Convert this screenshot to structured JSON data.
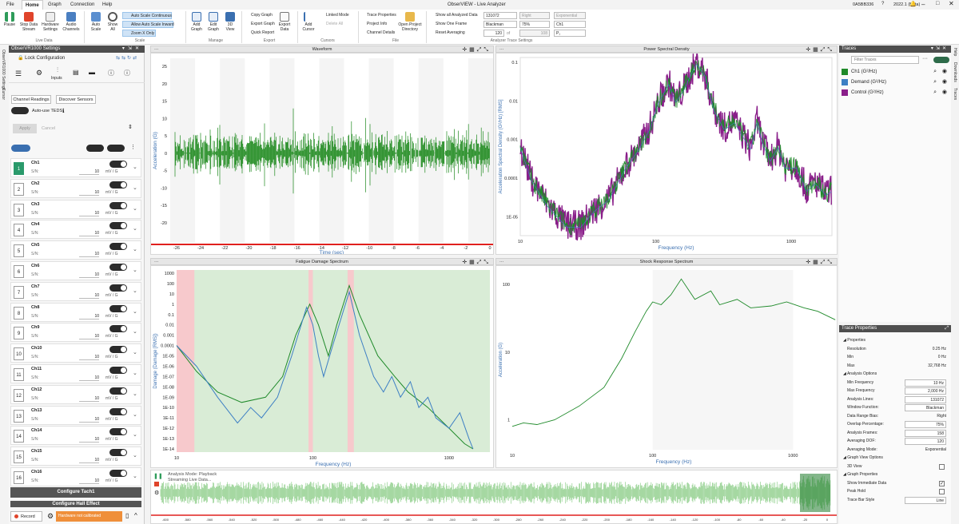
{
  "window": {
    "title": "ObserVIEW - Live Analyzer",
    "device": "0A5BB336",
    "version": "2022.1 (Beta)"
  },
  "menu": [
    "File",
    "Home",
    "Graph",
    "Connection",
    "Help"
  ],
  "ribbon": {
    "pause": "Pause",
    "stop": "Stop Data Stream",
    "hardware": "Hardware Settings",
    "audio": "Audio Channels",
    "auto_scale": "Auto Scale",
    "show_all": "Show All",
    "auto_scale_continuous": "Auto Scale Continuous",
    "allow_auto_scale_inward": "Allow Auto Scale Inward",
    "zoom_x_only": "Zoom X Only",
    "add_graph": "Add Graph",
    "edit_graph": "Edit Graph",
    "view_3d": "3D View",
    "copy_graph": "Copy Graph",
    "export_graph": "Export Graph",
    "quick_report": "Quick Report",
    "export_data": "Export Data",
    "add_cursor": "Add Cursor",
    "linked_mode": "Linked Mode",
    "delete_all": "Delete All",
    "trace_properties": "Trace Properties",
    "project_info": "Project Info",
    "channel_details": "Channel Details",
    "open_project_dir": "Open Project Directory",
    "show_all_analyzed": "Show all Analyzed Data",
    "show_one_frame": "Show One Frame",
    "reset_averaging": "Reset Averaging",
    "lines_value": "131072",
    "window_value": "Blackman",
    "overlap_value": "75%",
    "avg_value": "120",
    "avg_of": "of",
    "avg_total": "108",
    "bias_value": "Right",
    "ch_value": "Ch1",
    "mode_value": "Exponential",
    "unit_value": "P₁",
    "groups": [
      "Live Data",
      "Scale",
      "Manage",
      "Export",
      "Cursors",
      "File",
      "Analyzer Trace Settings"
    ]
  },
  "left_panel": {
    "title": "ObserVR1000 Settings",
    "lock": "Lock Configuration",
    "inputs_tab": "Inputs",
    "channel_readings": "Channel Readings",
    "discover_sensors": "Discover Sensors",
    "auto_teds": "Auto-use TEDS",
    "apply": "Apply",
    "cancel": "Cancel",
    "sn_label": "S/N:",
    "sensitivity": "10",
    "unit": "mV / G",
    "channels": [
      "Ch1",
      "Ch2",
      "Ch3",
      "Ch4",
      "Ch5",
      "Ch6",
      "Ch7",
      "Ch8",
      "Ch9",
      "Ch10",
      "Ch11",
      "Ch12",
      "Ch13",
      "Ch14",
      "Ch15",
      "Ch16"
    ],
    "numbers": [
      "1",
      "2",
      "3",
      "4",
      "5",
      "6",
      "7",
      "8",
      "9",
      "10",
      "11",
      "12",
      "13",
      "14",
      "15",
      "16"
    ],
    "configure_tach": "Configure Tach1",
    "configure_hall": "Configure Hall Effect",
    "record": "Record",
    "hw_not_calibrated": "Hardware not calibrated",
    "vertical_tabs": [
      "ObserVR1000 Settings",
      "Cursor"
    ]
  },
  "graphs": {
    "waveform": {
      "title": "Waveform",
      "xlabel": "Time (sec)",
      "ylabel": "Acceleration (G)",
      "xticks": [
        "-26",
        "-24",
        "-22",
        "-20",
        "-18",
        "-16",
        "-14",
        "-12",
        "-10",
        "-8",
        "-6",
        "-4",
        "-2",
        "0"
      ],
      "yticks": [
        "25",
        "20",
        "15",
        "10",
        "5",
        "0",
        "-5",
        "-10",
        "-15",
        "-20"
      ]
    },
    "psd": {
      "title": "Power Spectral Density",
      "xlabel": "Frequency (Hz)",
      "ylabel": "Acceleration Spectral Density (G²/Hz) [RMS]",
      "xticks": [
        "10",
        "100",
        "1000"
      ],
      "yticks": [
        "0.1",
        "0.01",
        "0.001",
        "0.0001",
        "1E-05"
      ]
    },
    "fds": {
      "title": "Fatigue Damage Spectrum",
      "xlabel": "Frequency (Hz)",
      "ylabel": "Damage (Damage [RMS])",
      "xticks": [
        "10",
        "100",
        "1000"
      ],
      "yticks": [
        "1000",
        "100",
        "10",
        "1",
        "0.1",
        "0.01",
        "0.001",
        "0.0001",
        "1E-05",
        "1E-06",
        "1E-07",
        "1E-08",
        "1E-09",
        "1E-10",
        "1E-11",
        "1E-12",
        "1E-13",
        "1E-14"
      ]
    },
    "srs": {
      "title": "Shock Response Spectrum",
      "xlabel": "Frequency (Hz)",
      "ylabel": "Acceleration (G)",
      "xticks": [
        "10",
        "100",
        "1000"
      ],
      "yticks": [
        "100",
        "10",
        "1"
      ]
    },
    "playback": {
      "mode": "Analysis Mode: Playback",
      "streaming": "Streaming Live Data...",
      "xticks": [
        "-600",
        "-580",
        "-560",
        "-540",
        "-520",
        "-500",
        "-480",
        "-460",
        "-440",
        "-420",
        "-400",
        "-380",
        "-360",
        "-340",
        "-320",
        "-300",
        "-280",
        "-260",
        "-240",
        "-220",
        "-200",
        "-180",
        "-160",
        "-140",
        "-120",
        "-100",
        "-80",
        "-60",
        "-40",
        "-20",
        "0"
      ]
    }
  },
  "traces": {
    "title": "Traces",
    "filter_placeholder": "Filter Traces",
    "items": [
      {
        "label": "Ch1 (G²/Hz)",
        "color": "#1f8a2a"
      },
      {
        "label": "Demand (G²/Hz)",
        "color": "#3d7fc4"
      },
      {
        "label": "Control (G²/Hz)",
        "color": "#8a1f8a"
      }
    ]
  },
  "trace_properties": {
    "title": "Trace Properties",
    "properties": "Properties",
    "resolution": "Resolution",
    "resolution_val": "0.25 Hz",
    "min": "Min",
    "min_val": "0 Hz",
    "max": "Max",
    "max_val": "32,768 Hz",
    "analysis_options": "Analysis Options",
    "min_freq": "Min Frequency",
    "min_freq_val": "10 Hz",
    "max_freq": "Max Frequency",
    "max_freq_val": "2,000 Hz",
    "lines": "Analysis Lines:",
    "lines_val": "131072",
    "window": "Window Function:",
    "window_val": "Blackman",
    "bias": "Data Range Bias:",
    "bias_val": "Right",
    "overlap": "Overlap Percentage:",
    "overlap_val": "75%",
    "frames": "Analysis Frames:",
    "frames_val": "158",
    "dof": "Averaging DOF:",
    "dof_val": "120",
    "mode": "Averaging Mode:",
    "mode_val": "Exponential",
    "graph_view": "Graph View Options",
    "view3d": "3D View",
    "graph_props": "Graph Properties",
    "show_immediate": "Show Immediate Data",
    "peak_hold": "Peak Hold",
    "trace_bar": "Trace Bar Style",
    "trace_bar_val": "Line"
  },
  "right_vtabs": [
    "Help",
    "Downloads",
    "Traces"
  ]
}
